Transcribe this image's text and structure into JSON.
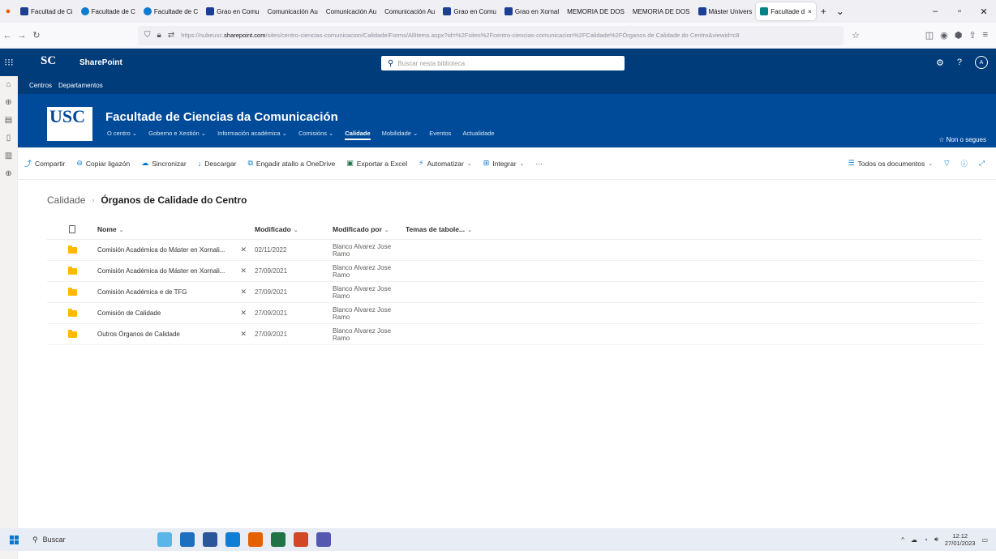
{
  "browser": {
    "tabs": [
      {
        "label": "Facultad de Ci",
        "fav": "blue"
      },
      {
        "label": "Facultade de C",
        "fav": "circ"
      },
      {
        "label": "Facultade de C",
        "fav": "circ"
      },
      {
        "label": "Grao en Comu",
        "fav": "blue"
      },
      {
        "label": "Comunicación Au",
        "fav": "none"
      },
      {
        "label": "Comunicación Au",
        "fav": "none"
      },
      {
        "label": "Comunicación Au",
        "fav": "none"
      },
      {
        "label": "Grao en Comu",
        "fav": "blue"
      },
      {
        "label": "Grao en Xornal",
        "fav": "blue"
      },
      {
        "label": "MEMORIA DE DOS",
        "fav": "none"
      },
      {
        "label": "MEMORIA DE DOS",
        "fav": "none"
      },
      {
        "label": "Máster Univers",
        "fav": "blue"
      }
    ],
    "active_tab": "Facultade d",
    "url_prefix": "https://nubeusc.",
    "url_host": "sharepoint.com",
    "url_rest": "/sites/centro-ciencias-comunicacion/Calidade/Forms/AllItems.aspx?id=%2Fsites%2Fcentro-ciencias-comunicacion%2FCalidade%2FÓrganos de Calidade do Centro&viewid=c8"
  },
  "suite": {
    "logo": "SC",
    "app_name": "SharePoint",
    "search_placeholder": "Buscar nesta biblioteca",
    "avatar_initial": "A"
  },
  "hubnav": [
    "Centros",
    "Departamentos"
  ],
  "site": {
    "logo": "USC",
    "title": "Facultade de Ciencias da Comunicación",
    "nav": [
      {
        "label": "O centro",
        "dropdown": true
      },
      {
        "label": "Goberno e Xestión",
        "dropdown": true
      },
      {
        "label": "Información académica",
        "dropdown": true
      },
      {
        "label": "Comisións",
        "dropdown": true
      },
      {
        "label": "Calidade",
        "dropdown": false,
        "active": true
      },
      {
        "label": "Mobilidade",
        "dropdown": true
      },
      {
        "label": "Eventos",
        "dropdown": false
      },
      {
        "label": "Actualidade",
        "dropdown": false
      }
    ],
    "follow_label": "Non o segues"
  },
  "commands": {
    "share": "Compartir",
    "copy_link": "Copiar ligazón",
    "sync": "Sincronizar",
    "download": "Descargar",
    "add_shortcut": "Engadir atallo a OneDrive",
    "export_excel": "Exportar a Excel",
    "automate": "Automatizar",
    "integrate": "Integrar",
    "more": "···",
    "view": "Todos os documentos"
  },
  "breadcrumb": {
    "parent": "Calidade",
    "current": "Órganos de Calidade do Centro"
  },
  "list": {
    "headers": {
      "name": "Nome",
      "modified": "Modificado",
      "modified_by": "Modificado por",
      "temas": "Temas de tabole..."
    },
    "rows": [
      {
        "name": "Comisión Académica do Máster en Xornali...",
        "modified": "02/11/2022",
        "modified_by": "Blanco Alvarez Jose Ramo"
      },
      {
        "name": "Comisión Académica do Máster en Xornali...",
        "modified": "27/09/2021",
        "modified_by": "Blanco Alvarez Jose Ramo"
      },
      {
        "name": "Comisión Académica e de TFG",
        "modified": "27/09/2021",
        "modified_by": "Blanco Alvarez Jose Ramo"
      },
      {
        "name": "Comisión de Calidade",
        "modified": "27/09/2021",
        "modified_by": "Blanco Alvarez Jose Ramo"
      },
      {
        "name": "Outros Órganos de Calidade",
        "modified": "27/09/2021",
        "modified_by": "Blanco Alvarez Jose Ramo"
      }
    ]
  },
  "taskbar": {
    "search": "Buscar",
    "time": "12:12",
    "date": "27/01/2023"
  },
  "colors": {
    "suite_bar": "#003b7a",
    "site_header": "#004b99",
    "accent": "#0078d4",
    "folder": "#ffb900"
  }
}
